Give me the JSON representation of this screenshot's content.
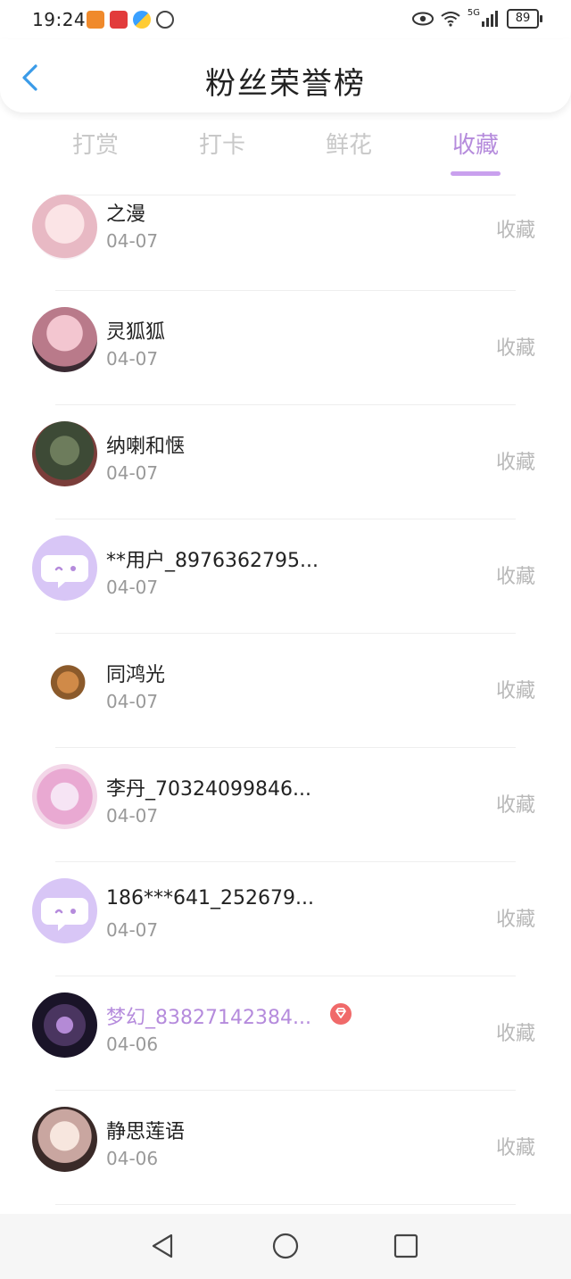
{
  "status_bar": {
    "time": "19:24",
    "network": "5G",
    "battery": "89",
    "notification_icons": [
      "video-app-icon",
      "news-app-icon",
      "pinwheel-icon",
      "hand-icon"
    ]
  },
  "header": {
    "title": "粉丝荣誉榜"
  },
  "tabs": [
    {
      "label": "打赏"
    },
    {
      "label": "打卡"
    },
    {
      "label": "鲜花"
    },
    {
      "label": "收藏"
    }
  ],
  "active_tab": "收藏",
  "colors": {
    "accent": "#b58bdc",
    "tab_inactive": "#c8c8c8",
    "placeholder_avatar": "#d8c6f6",
    "gem": "#f06a6a"
  },
  "rows": [
    {
      "name": "之漫",
      "date": "04-07",
      "action": "收藏"
    },
    {
      "name": "灵狐狐",
      "date": "04-07",
      "action": "收藏"
    },
    {
      "name": "纳喇和惬",
      "date": "04-07",
      "action": "收藏"
    },
    {
      "name": "**用户_8976362795...",
      "date": "04-07",
      "action": "收藏"
    },
    {
      "name": "同鸿光",
      "date": "04-07",
      "action": "收藏"
    },
    {
      "name": "李丹_70324099846...",
      "date": "04-07",
      "action": "收藏"
    },
    {
      "name": "186***641_252679...",
      "date": "04-07",
      "action": "收藏"
    },
    {
      "name": "梦幻_83827142384...",
      "date": "04-06",
      "action": "收藏"
    },
    {
      "name": "静思莲语",
      "date": "04-06",
      "action": "收藏"
    }
  ]
}
